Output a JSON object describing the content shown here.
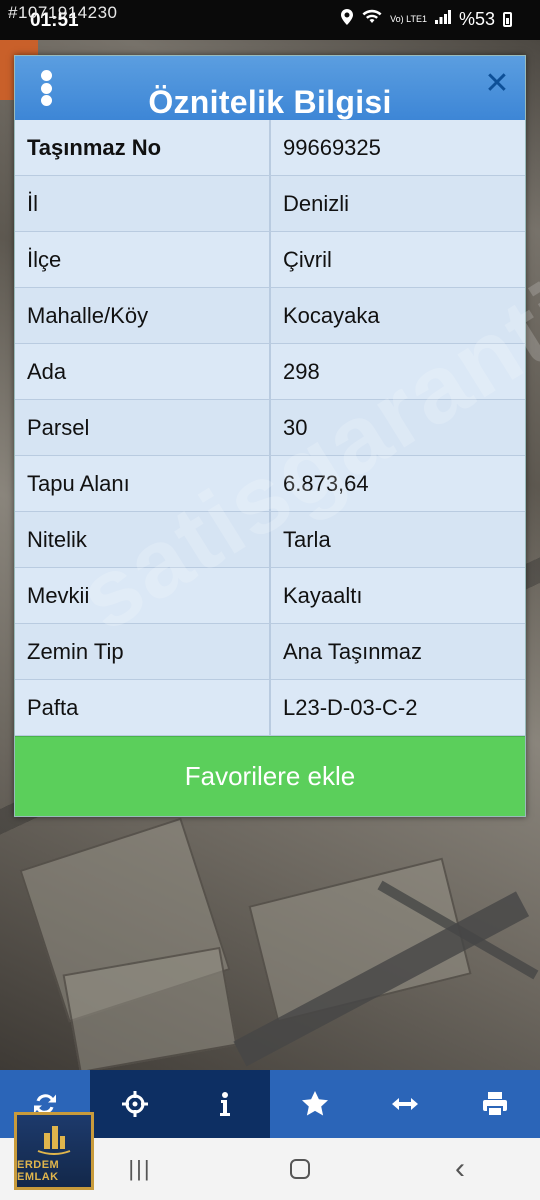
{
  "status_bar": {
    "overlay_id": "#1071914230",
    "time": "01:51",
    "network": "Vo) LTE1",
    "battery": "%53"
  },
  "dialog": {
    "title": "Öznitelik Bilgisi",
    "rows": [
      {
        "label": "Taşınmaz No",
        "value": "99669325"
      },
      {
        "label": "İl",
        "value": "Denizli"
      },
      {
        "label": "İlçe",
        "value": "Çivril"
      },
      {
        "label": "Mahalle/Köy",
        "value": "Kocayaka"
      },
      {
        "label": "Ada",
        "value": "298"
      },
      {
        "label": "Parsel",
        "value": "30"
      },
      {
        "label": "Tapu Alanı",
        "value": "6.873,64"
      },
      {
        "label": "Nitelik",
        "value": "Tarla"
      },
      {
        "label": "Mevkii",
        "value": "Kayaaltı"
      },
      {
        "label": "Zemin Tip",
        "value": "Ana Taşınmaz"
      },
      {
        "label": "Pafta",
        "value": "L23-D-03-C-2"
      }
    ],
    "favorite_button": "Favorilere ekle"
  },
  "watermark": "satisgaranti",
  "toolbar": {
    "items": [
      "refresh-icon",
      "crosshair-icon",
      "info-icon",
      "star-icon",
      "measure-icon",
      "print-icon"
    ]
  },
  "logo": {
    "text": "ERDEM EMLAK"
  },
  "colors": {
    "header_blue": "#3d86d6",
    "table_bg": "#d7e6f5",
    "favorite_green": "#5bcf5b",
    "toolbar_blue": "#2b65b8",
    "toolbar_dark": "#0d2f63"
  }
}
